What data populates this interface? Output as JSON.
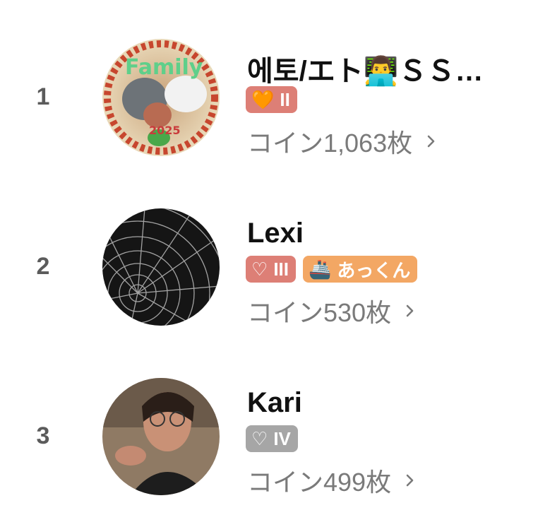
{
  "ranking": [
    {
      "rank": "1",
      "name": "에토/エト👨‍💻ＳＳ…",
      "badges": [
        {
          "label": "II",
          "glyph": "🧡",
          "color": "#dd7f76"
        }
      ],
      "coins": "コイン1,063枚",
      "avatar_text": "Family",
      "avatar_year": "2025"
    },
    {
      "rank": "2",
      "name": "Lexi",
      "badges": [
        {
          "label": "III",
          "glyph": "♡",
          "color": "#dd7f76"
        },
        {
          "label": "あっくん",
          "glyph": "🚢",
          "color": "#f3a764"
        }
      ],
      "coins": "コイン530枚"
    },
    {
      "rank": "3",
      "name": "Kari",
      "badges": [
        {
          "label": "IV",
          "glyph": "♡",
          "color": "#a6a6a6"
        }
      ],
      "coins": "コイン499枚"
    }
  ]
}
